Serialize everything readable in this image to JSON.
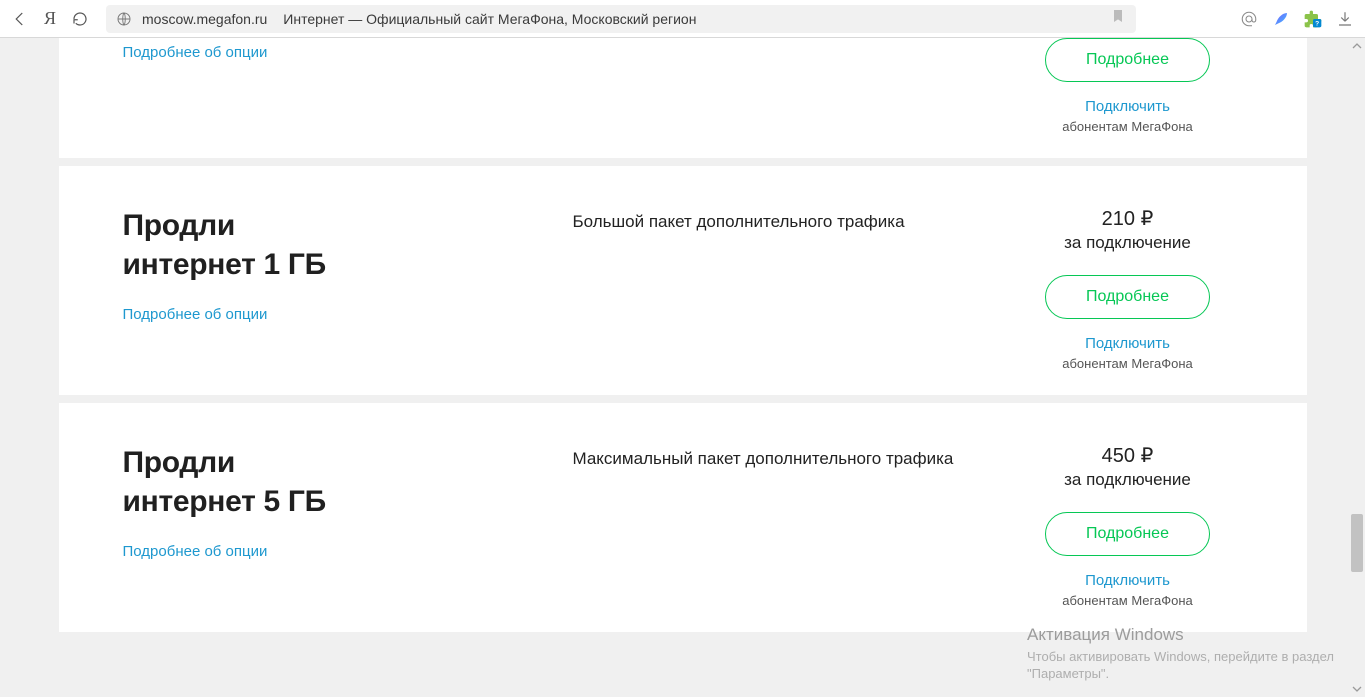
{
  "browser": {
    "url_host": "moscow.megafon.ru",
    "page_title": "Интернет — Официальный сайт МегаФона, Московский регион"
  },
  "cards": {
    "partial": {
      "more_link": "Подробнее об опции",
      "details_btn": "Подробнее",
      "connect_link": "Подключить",
      "sub_note": "абонентам МегаФона"
    },
    "c1": {
      "title_l1": "Продли",
      "title_l2": "интернет 1 ГБ",
      "more_link": "Подробнее об опции",
      "desc": "Большой пакет дополнительного трафика",
      "price": "210 ₽",
      "price_sub": "за подключение",
      "details_btn": "Подробнее",
      "connect_link": "Подключить",
      "sub_note": "абонентам МегаФона"
    },
    "c2": {
      "title_l1": "Продли",
      "title_l2": "интернет 5 ГБ",
      "more_link": "Подробнее об опции",
      "desc": "Максимальный пакет дополнительного трафика",
      "price": "450 ₽",
      "price_sub": "за подключение",
      "details_btn": "Подробнее",
      "connect_link": "Подключить",
      "sub_note": "абонентам МегаФона"
    }
  },
  "watermark": {
    "line1": "Активация Windows",
    "line2": "Чтобы активировать Windows, перейдите в раздел \"Параметры\"."
  }
}
